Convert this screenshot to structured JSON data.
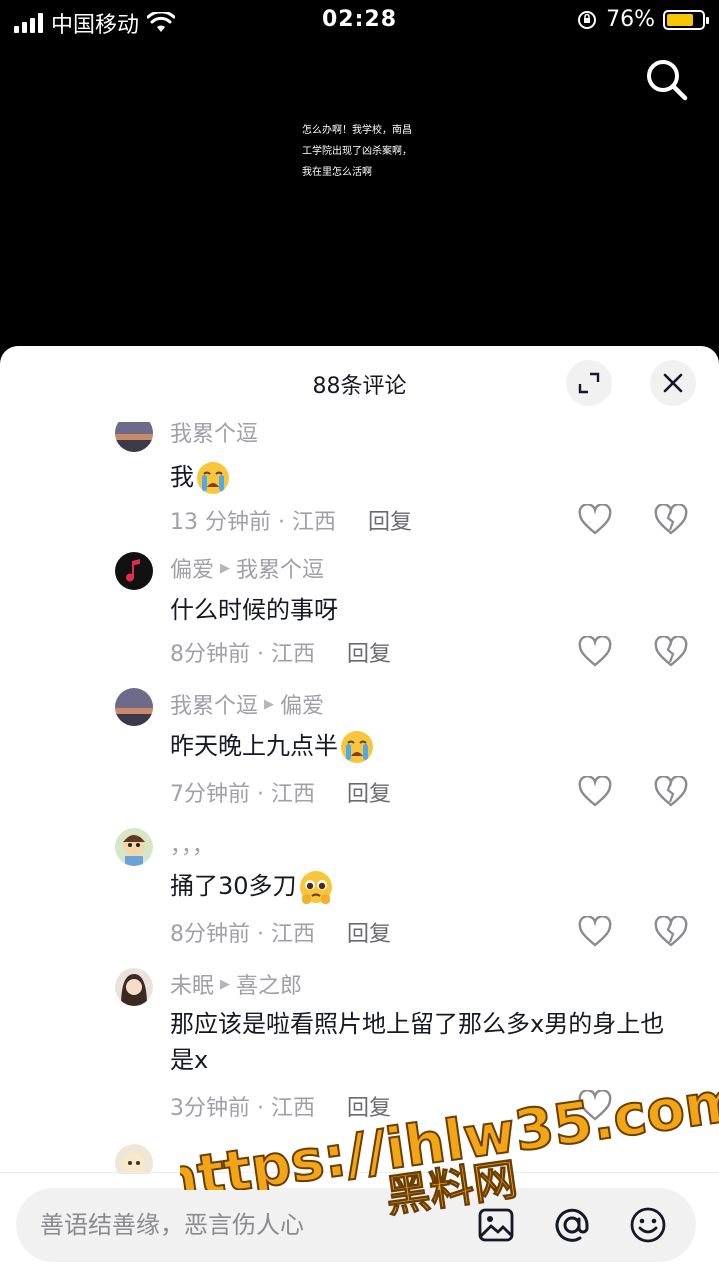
{
  "status_bar": {
    "carrier": "中国移动",
    "time": "02:28",
    "battery": "76%",
    "battery_level": 0.76
  },
  "video": {
    "caption": "怎么办啊！我学校，南昌工学院出现了凶杀案啊，我在里怎么活啊"
  },
  "sheet": {
    "title": "88条评论"
  },
  "comments": [
    {
      "user": "我累个逗",
      "reply_to": "",
      "text": "我",
      "emoji": "crying-face",
      "time": "13 分钟前 · 江西",
      "reply_label": "回复",
      "avatar": "sunset"
    },
    {
      "user": "偏爱",
      "reply_to": "我累个逗",
      "text": "什么时候的事呀",
      "emoji": "",
      "time": "8分钟前 · 江西",
      "reply_label": "回复",
      "avatar": "music"
    },
    {
      "user": "我累个逗",
      "reply_to": "偏爱",
      "text": "昨天晚上九点半",
      "emoji": "crying-face",
      "time": "7分钟前 · 江西",
      "reply_label": "回复",
      "avatar": "sunset"
    },
    {
      "user": "，，，",
      "reply_to": "",
      "text": "捅了30多刀",
      "emoji": "pleading-face",
      "time": "8分钟前 · 江西",
      "reply_label": "回复",
      "avatar": "cartoon"
    },
    {
      "user": "未眠",
      "reply_to": "喜之郎",
      "text": "那应该是啦看照片地上留了那么多x男的身上也是x",
      "emoji": "",
      "time": "3分钟前 · 江西",
      "reply_label": "回复",
      "avatar": "girl"
    }
  ],
  "input": {
    "placeholder": "善语结善缘，恶言伤人心"
  },
  "watermark": {
    "line1": "https://ihlw35.com",
    "line2": "黑料网"
  },
  "colors": {
    "watermark_fill": "#f2a516",
    "battery": "#f6c700",
    "muted_text": "#a0a0a6"
  }
}
